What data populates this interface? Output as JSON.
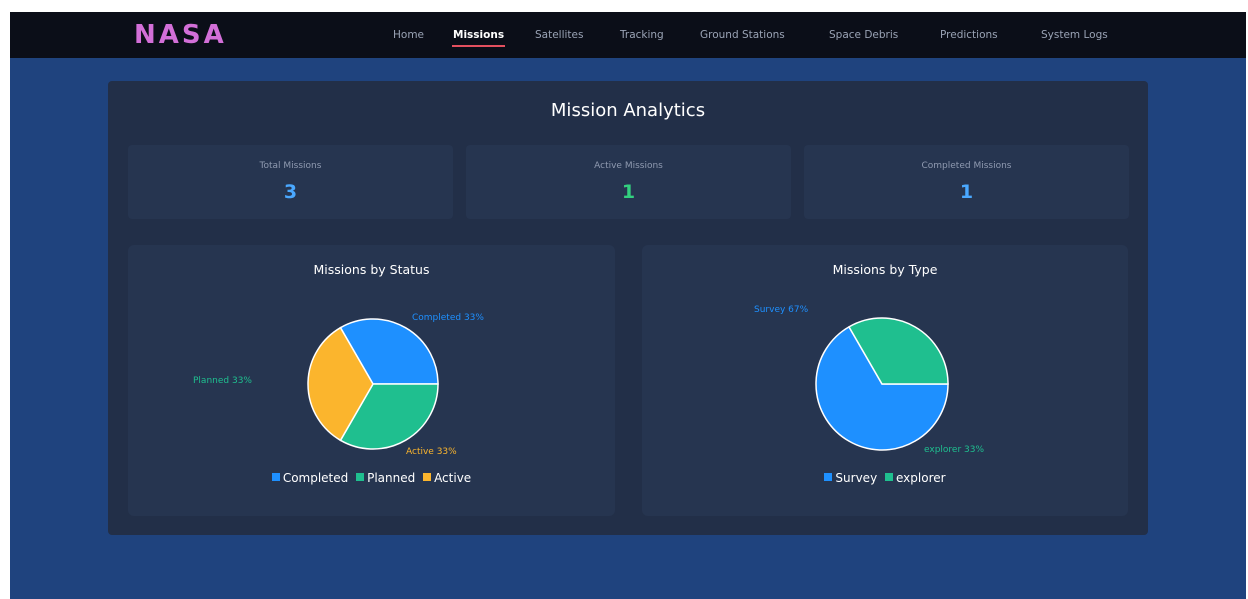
{
  "colors": {
    "completed": "#1e90ff",
    "planned": "#1fbf8f",
    "active": "#fbb52d",
    "survey": "#1e90ff",
    "explorer": "#1fbf8f",
    "total_value": "#4aa8ff",
    "active_value": "#33d07f",
    "completed_value": "#4aa8ff"
  },
  "brand": {
    "logo": "NASA"
  },
  "nav": [
    {
      "label": "Home",
      "active": false
    },
    {
      "label": "Missions",
      "active": true
    },
    {
      "label": "Satellites",
      "active": false
    },
    {
      "label": "Tracking",
      "active": false
    },
    {
      "label": "Ground Stations",
      "active": false
    },
    {
      "label": "Space Debris",
      "active": false
    },
    {
      "label": "Predictions",
      "active": false
    },
    {
      "label": "System Logs",
      "active": false
    }
  ],
  "page": {
    "title": "Mission Analytics"
  },
  "stats": [
    {
      "label": "Total Missions",
      "value": "3"
    },
    {
      "label": "Active Missions",
      "value": "1"
    },
    {
      "label": "Completed Missions",
      "value": "1"
    }
  ],
  "chart_data": [
    {
      "type": "pie",
      "title": "Missions by Status",
      "categories": [
        "Completed",
        "Planned",
        "Active"
      ],
      "values": [
        1,
        1,
        1
      ],
      "slice_labels": [
        "Completed 33%",
        "Planned 33%",
        "Active 33%"
      ],
      "legend_position": "bottom"
    },
    {
      "type": "pie",
      "title": "Missions by Type",
      "categories": [
        "Survey",
        "explorer"
      ],
      "values": [
        2,
        1
      ],
      "slice_labels": [
        "Survey 67%",
        "explorer 33%"
      ],
      "legend_position": "bottom"
    }
  ]
}
